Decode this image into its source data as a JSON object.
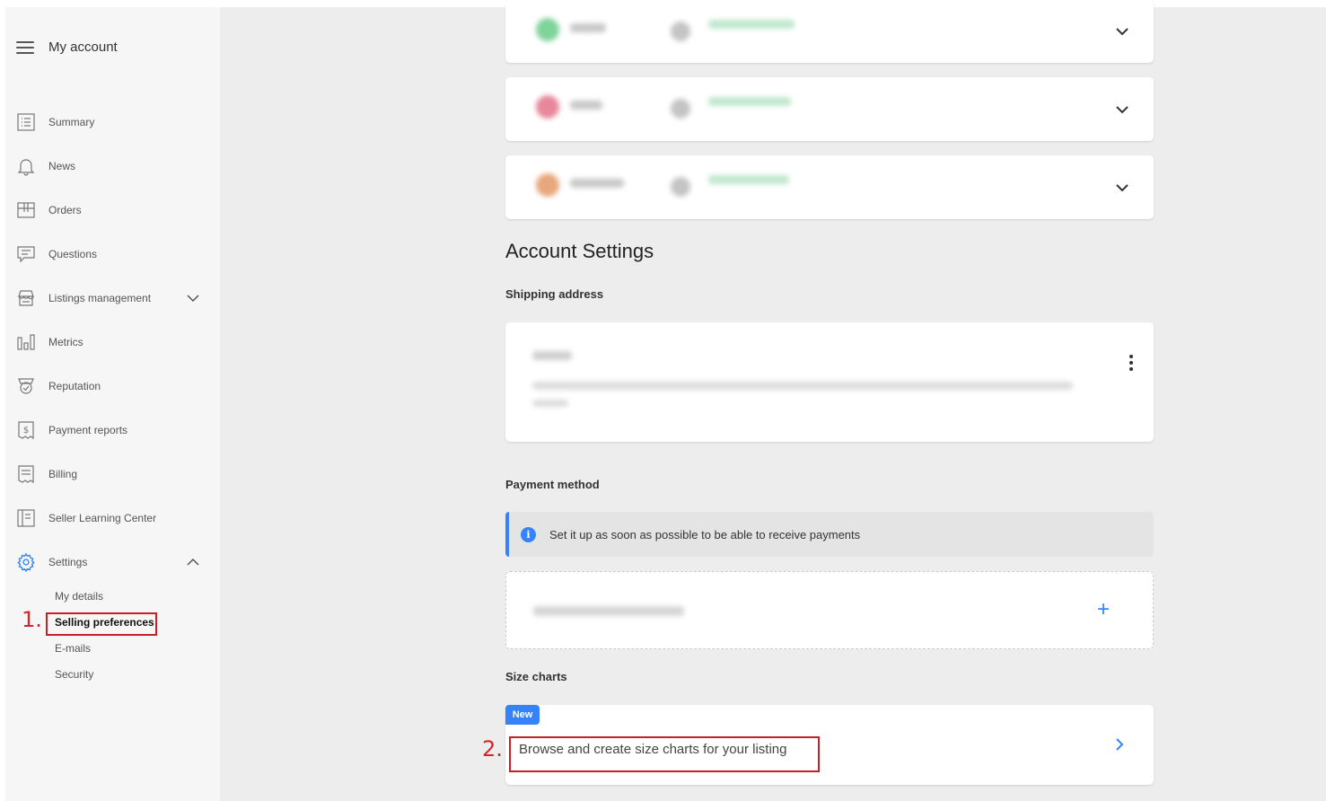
{
  "sidebar": {
    "title": "My account",
    "items": [
      {
        "label": "Summary",
        "icon": "summary-icon"
      },
      {
        "label": "News",
        "icon": "bell-icon"
      },
      {
        "label": "Orders",
        "icon": "box-icon"
      },
      {
        "label": "Questions",
        "icon": "chat-icon"
      },
      {
        "label": "Listings management",
        "icon": "store-icon"
      },
      {
        "label": "Metrics",
        "icon": "bar-chart-icon"
      },
      {
        "label": "Reputation",
        "icon": "medal-icon"
      },
      {
        "label": "Payment reports",
        "icon": "dollar-receipt-icon"
      },
      {
        "label": "Billing",
        "icon": "receipt-icon"
      },
      {
        "label": "Seller Learning Center",
        "icon": "book-icon"
      },
      {
        "label": "Settings",
        "icon": "gear-icon"
      }
    ],
    "settings_subitems": [
      "My details",
      "Selling preferences",
      "E-mails",
      "Security"
    ]
  },
  "annotations": {
    "step1": "1.",
    "step2": "2."
  },
  "main": {
    "account_settings_title": "Account Settings",
    "shipping_address_label": "Shipping address",
    "payment_method_label": "Payment method",
    "payment_info_text": "Set it up as soon as possible to be able to receive payments",
    "size_charts_label": "Size charts",
    "new_badge": "New",
    "size_charts_link": "Browse and create size charts for your listing"
  },
  "colors": {
    "accent": "#3483fa",
    "annotation_red": "#d8232a"
  }
}
